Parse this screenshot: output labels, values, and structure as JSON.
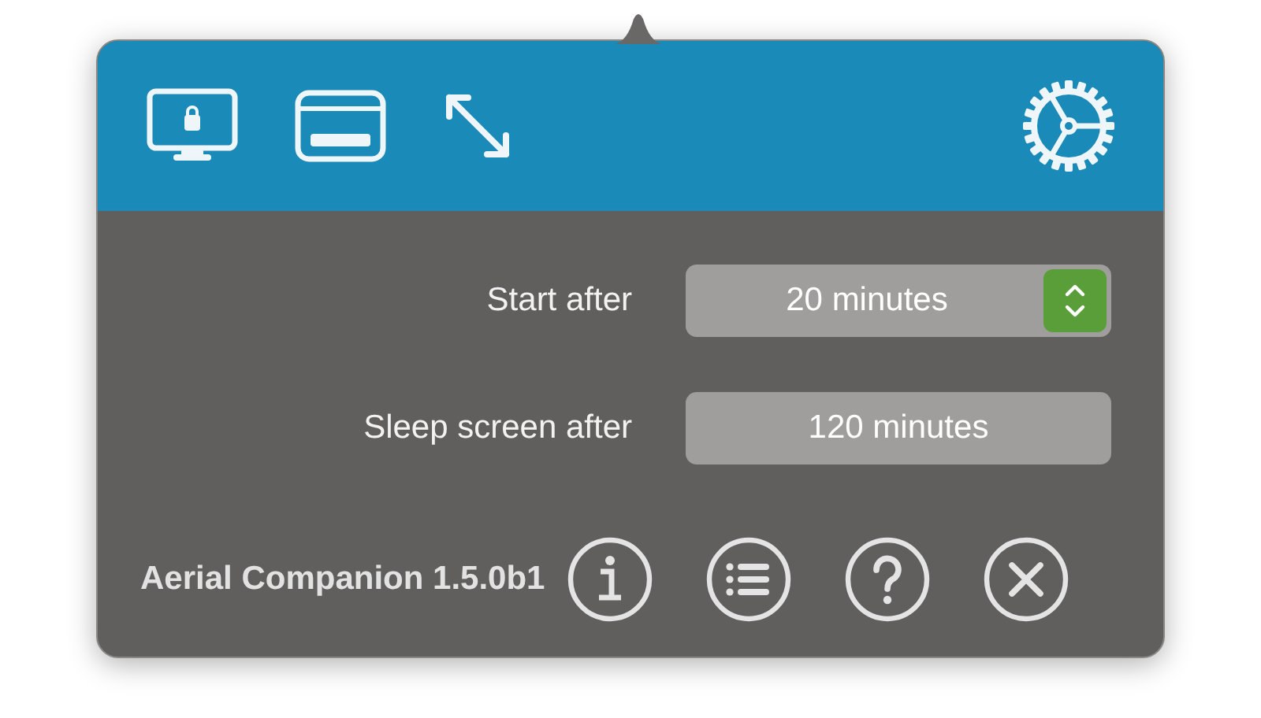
{
  "settings": [
    {
      "label": "Start after",
      "kind": "popup",
      "value": "20 minutes"
    },
    {
      "label": "Sleep screen after",
      "kind": "field",
      "value": "120 minutes"
    }
  ],
  "footer": {
    "app_name": "Aerial Companion 1.5.0b1"
  }
}
